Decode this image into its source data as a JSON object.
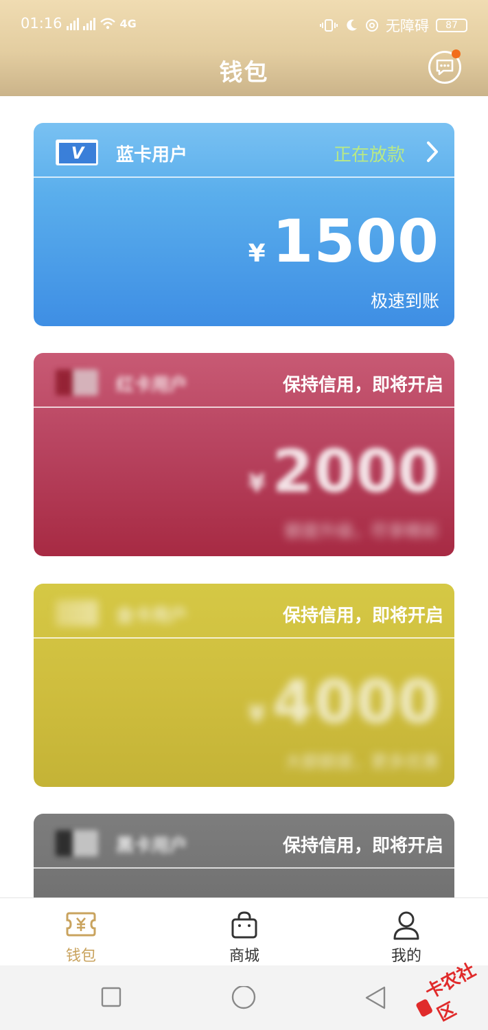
{
  "status_bar": {
    "time": "01:16",
    "network_type": "4G",
    "accessibility": "无障碍",
    "battery": "87"
  },
  "header": {
    "title": "钱包"
  },
  "cards": [
    {
      "name": "蓝卡用户",
      "logo_text": "V",
      "status": "正在放款",
      "currency": "¥",
      "amount": "1500",
      "subtitle": "极速到账",
      "color": "#5aaeec"
    },
    {
      "name": "红卡用户",
      "status": "保持信用，即将开启",
      "currency": "¥",
      "amount": "2000",
      "subtitle": "额度升级，尽享精彩",
      "color": "#b84460"
    },
    {
      "name": "金卡用户",
      "status": "保持信用，即将开启",
      "currency": "¥",
      "amount": "4000",
      "subtitle": "大额额度，更多优惠",
      "color": "#cfbe3e"
    },
    {
      "name": "黑卡用户",
      "status": "保持信用，即将开启",
      "color": "#777777"
    }
  ],
  "bottom_nav": [
    {
      "label": "钱包",
      "icon": "wallet-icon",
      "active": true
    },
    {
      "label": "商城",
      "icon": "shopping-bag-icon",
      "active": false
    },
    {
      "label": "我的",
      "icon": "user-icon",
      "active": false
    }
  ],
  "watermark": {
    "text": "卡农社区"
  },
  "colors": {
    "accent_gold": "#c9a35e",
    "header_gold": "#e3cda0",
    "notification_dot": "#f26d1c"
  }
}
